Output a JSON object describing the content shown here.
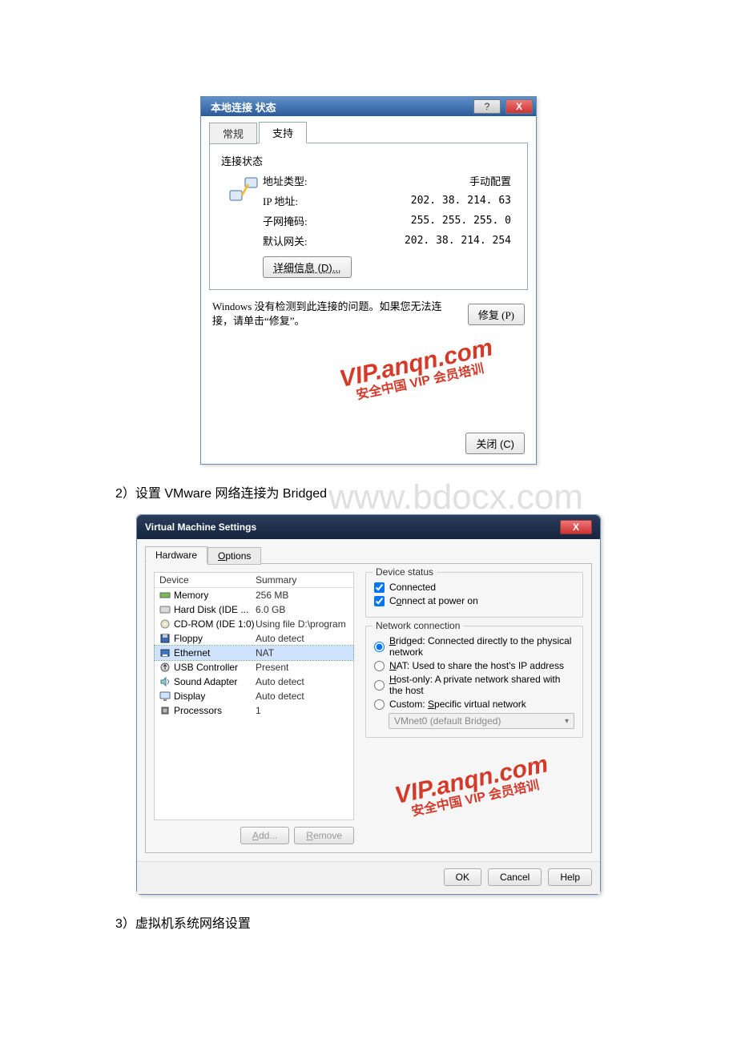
{
  "watermark": {
    "line1": "VIP.anqn.com",
    "line2": "安全中国 VIP 会员培训"
  },
  "bdocx": "www.bdocx.com",
  "win1": {
    "title": "本地连接 状态",
    "help_hint": "?",
    "close_hint": "X",
    "tabs": {
      "general": "常规",
      "support": "支持"
    },
    "group_title": "连接状态",
    "rows": {
      "addr_type_label": "地址类型:",
      "addr_type_value": "手动配置",
      "ip_label": "IP 地址:",
      "ip_value": "202. 38. 214. 63",
      "mask_label": "子网掩码:",
      "mask_value": "255. 255. 255. 0",
      "gw_label": "默认网关:",
      "gw_value": "202. 38. 214. 254"
    },
    "details_btn": "详细信息 (D)...",
    "repair_msg": "Windows 没有检测到此连接的问题。如果您无法连接，请单击“修复”。",
    "repair_btn": "修复 (P)",
    "close_btn": "关闭 (C)"
  },
  "step2": "2）设置 VMware 网络连接为 Bridged",
  "win2": {
    "title": "Virtual Machine Settings",
    "close_hint": "X",
    "tabs": {
      "hardware": "Hardware",
      "options": "Options"
    },
    "headers": {
      "device": "Device",
      "summary": "Summary"
    },
    "devices": [
      {
        "icon": "mem",
        "name": "Memory",
        "summary": "256 MB"
      },
      {
        "icon": "disk",
        "name": "Hard Disk (IDE ...",
        "summary": "6.0 GB"
      },
      {
        "icon": "cd",
        "name": "CD-ROM (IDE 1:0)",
        "summary": "Using file D:\\program file..."
      },
      {
        "icon": "floppy",
        "name": "Floppy",
        "summary": "Auto detect"
      },
      {
        "icon": "eth",
        "name": "Ethernet",
        "summary": "NAT",
        "selected": true
      },
      {
        "icon": "usb",
        "name": "USB Controller",
        "summary": "Present"
      },
      {
        "icon": "snd",
        "name": "Sound Adapter",
        "summary": "Auto detect"
      },
      {
        "icon": "disp",
        "name": "Display",
        "summary": "Auto detect"
      },
      {
        "icon": "cpu",
        "name": "Processors",
        "summary": "1"
      }
    ],
    "add_btn": "Add...",
    "remove_btn": "Remove",
    "device_status": {
      "legend": "Device status",
      "connected": "Connected",
      "connect_on_power": "Connect at power on"
    },
    "network": {
      "legend": "Network connection",
      "bridged": "Bridged: Connected directly to the physical network",
      "nat": "NAT: Used to share the host's IP address",
      "hostonly": "Host-only: A private network shared with the host",
      "custom": "Custom: Specific virtual network",
      "dropdown": "VMnet0 (default Bridged)"
    },
    "footer": {
      "ok": "OK",
      "cancel": "Cancel",
      "help": "Help"
    }
  },
  "step3": "3）虚拟机系统网络设置"
}
